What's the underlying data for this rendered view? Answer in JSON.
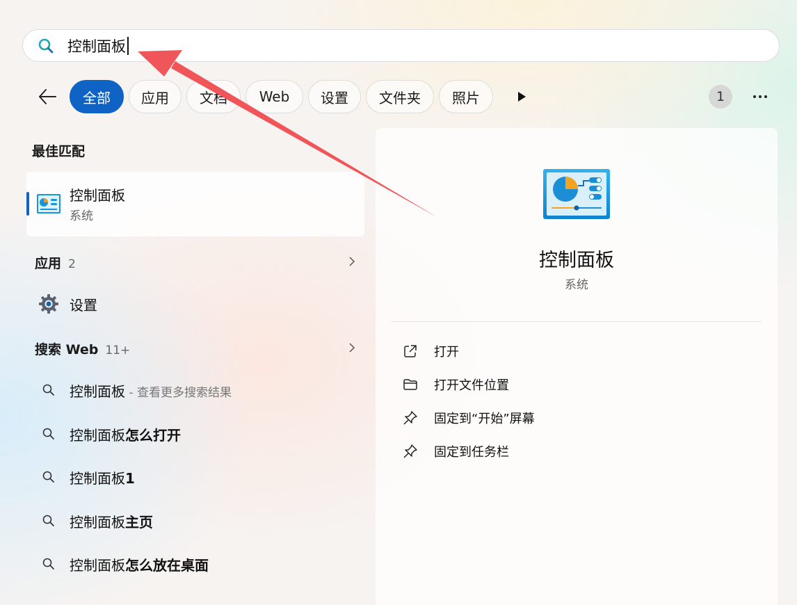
{
  "search": {
    "value": "控制面板"
  },
  "filters": [
    {
      "label": "全部",
      "active": true
    },
    {
      "label": "应用"
    },
    {
      "label": "文档"
    },
    {
      "label": "Web"
    },
    {
      "label": "设置"
    },
    {
      "label": "文件夹"
    },
    {
      "label": "照片"
    }
  ],
  "result_count_badge": "1",
  "best_match": {
    "section_title": "最佳匹配",
    "title": "控制面板",
    "subtitle": "系统"
  },
  "apps": {
    "section_title": "应用",
    "count": "2",
    "items": [
      {
        "label": "设置",
        "icon": "gear-icon"
      }
    ]
  },
  "web": {
    "section_title": "搜索 Web",
    "count": "11+",
    "items": [
      {
        "prefix": "控制面板",
        "suffix": "",
        "hint": " - 查看更多搜索结果"
      },
      {
        "prefix": "控制面板",
        "suffix": "怎么打开",
        "hint": ""
      },
      {
        "prefix": "控制面板",
        "suffix": "1",
        "hint": ""
      },
      {
        "prefix": "控制面板",
        "suffix": "主页",
        "hint": ""
      },
      {
        "prefix": "控制面板",
        "suffix": "怎么放在桌面",
        "hint": ""
      }
    ]
  },
  "preview": {
    "title": "控制面板",
    "subtitle": "系统",
    "actions": [
      {
        "label": "打开",
        "icon": "open-external-icon"
      },
      {
        "label": "打开文件位置",
        "icon": "folder-icon"
      },
      {
        "label": "固定到“开始”屏幕",
        "icon": "pin-icon"
      },
      {
        "label": "固定到任务栏",
        "icon": "pin-icon"
      }
    ]
  },
  "colors": {
    "accent": "#0f63c4",
    "annotation": "#f0555a"
  }
}
